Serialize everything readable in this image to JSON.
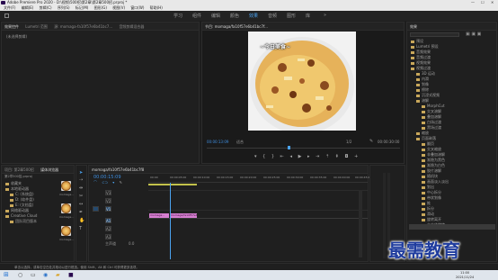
{
  "titlebar": {
    "title": "Adobe Premiere Pro 2020 - D:\\视频\\500招\\第2章\\第2章500招.prproj *",
    "controls": [
      "—",
      "☐",
      "✕"
    ]
  },
  "menubar": [
    "文件(F)",
    "编辑(E)",
    "剪辑(C)",
    "序列(S)",
    "标记(M)",
    "图形(G)",
    "视图(V)",
    "窗口(W)",
    "帮助(H)"
  ],
  "workspaces": [
    {
      "label": "学习",
      "active": false
    },
    {
      "label": "组件",
      "active": false
    },
    {
      "label": "编辑",
      "active": false
    },
    {
      "label": "颜色",
      "active": false
    },
    {
      "label": "效果",
      "active": true
    },
    {
      "label": "音频",
      "active": false
    },
    {
      "label": "图形",
      "active": false
    },
    {
      "label": "库",
      "active": false
    }
  ],
  "source_panel": {
    "tabs": [
      "效果控件",
      "Lumetri 范围",
      "源: momaga-fa10f57e6b41bc7...",
      "音频剪辑混合器"
    ],
    "message": "(未选择剪辑)"
  },
  "program_monitor": {
    "tab": "节目: momaga/fa10f57e6b41bc7f...",
    "caption": "~今日美食~",
    "timecode": "00:00:13:09",
    "fit": "适合",
    "quality": "1/2",
    "duration": "00:00:30:00"
  },
  "project_panel": {
    "tabs": [
      "项目: 第2章500招",
      "媒体浏览器"
    ],
    "path": "第2章500招.prproj",
    "items": [
      "收藏夹",
      "本地驱动器",
      "C: (系统盘)",
      "D: (软件盘)",
      "E: (文档盘)",
      "网络驱动器",
      "Creative Cloud",
      "团队项目版本"
    ],
    "thumb_labels": [
      "momaga...",
      "momaga...",
      "momaga..."
    ]
  },
  "timeline": {
    "tab": "momaga/fa10f57e6b41bc7f8",
    "timecode": "00:00:15:09",
    "ruler": [
      "00:00",
      "00:00:05:00",
      "00:00:10:00",
      "00:00:15:00",
      "00:00:20:00",
      "00:00:25:00",
      "00:00:30:00",
      "00:00:35:00",
      "00:00:40:00",
      "00:00:45:00"
    ],
    "tracks": [
      "V3",
      "V2",
      "V1",
      "A1",
      "A2",
      "A3",
      "主声道"
    ],
    "master_value": "0.0",
    "clips": [
      "momaga...",
      "momaga/fa10f57e6b4..."
    ]
  },
  "effects_panel": {
    "title": "效果",
    "items": [
      "预设",
      "Lumetri 预设",
      "音频效果",
      "音频过渡",
      "视频效果",
      "视频过渡",
      "3D 运动",
      "内滑",
      "划像",
      "擦除",
      "沉浸式视频",
      "溶解",
      "MorphCut",
      "交叉溶解",
      "叠加溶解",
      "白场过渡",
      "黑场过渡",
      "缩放",
      "页面剥落",
      "翻页",
      "交叉缩放",
      "非叠加溶解",
      "渐隐为黑色",
      "渐隐为白色",
      "胶片溶解",
      "随机块",
      "画面淡入淡出",
      "划出",
      "中心拆分",
      "带状划像",
      "推",
      "拆分",
      "滑动",
      "旋转离开",
      "立方体旋转"
    ]
  },
  "status_text": "单击以选择，或单击空白处并拖动以进行框选。使用 Shift、Alt 和 Ctrl 可获得更多选项。",
  "watermark": "最需教育",
  "taskbar": {
    "time": "11:00",
    "date": "2021/11/24"
  }
}
